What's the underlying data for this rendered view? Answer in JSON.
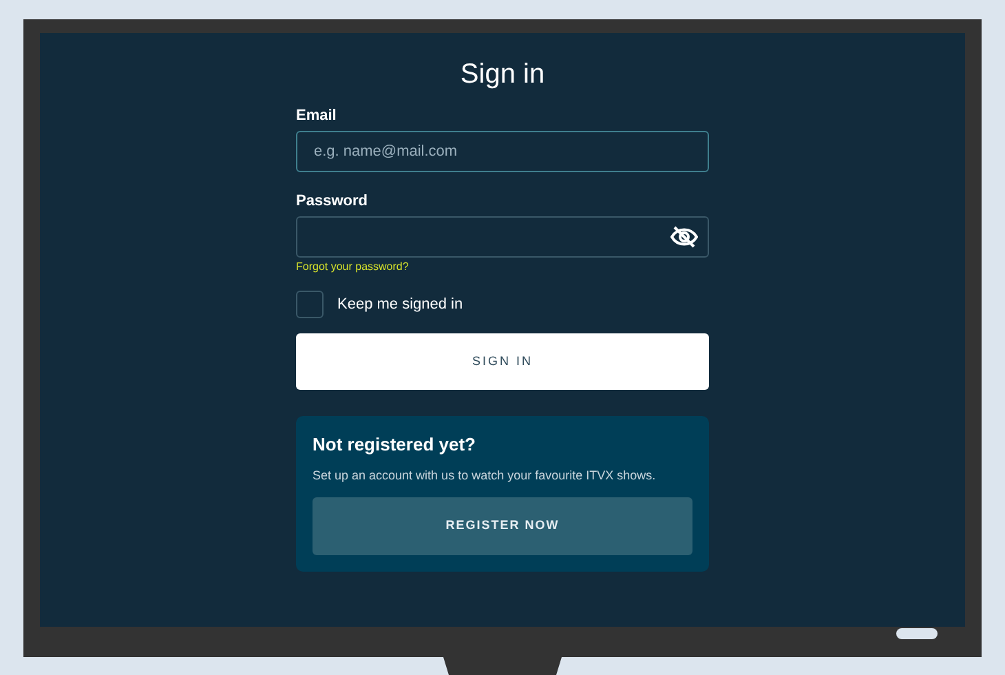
{
  "title": "Sign in",
  "email": {
    "label": "Email",
    "placeholder": "e.g. name@mail.com"
  },
  "password": {
    "label": "Password",
    "forgot_link": "Forgot your password?"
  },
  "keep_signed_in": {
    "label": "Keep me signed in",
    "checked": false
  },
  "sign_in_button": "SIGN IN",
  "register_card": {
    "heading": "Not registered yet?",
    "text": "Set up an account with us to watch your favourite ITVX shows.",
    "button": "REGISTER NOW"
  }
}
